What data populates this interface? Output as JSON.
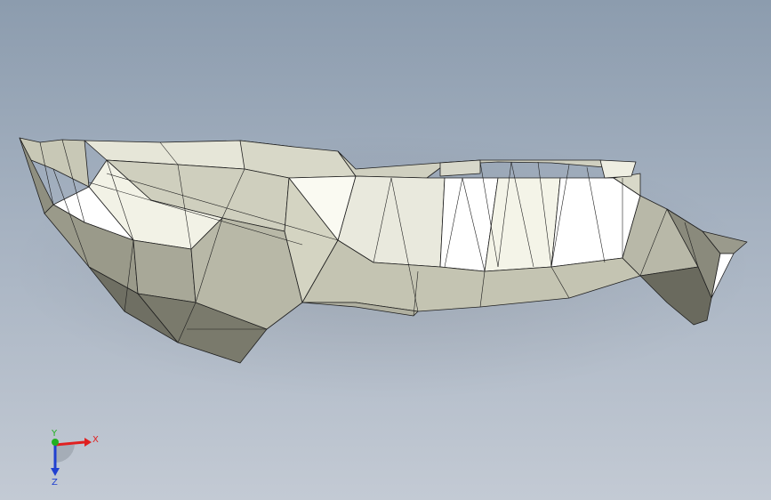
{
  "viewport": {
    "background_top": "#8c9cae",
    "background_bottom": "#c3cad4"
  },
  "model": {
    "icon": "mesh-part",
    "face_colors": {
      "highlight": "#ffffff",
      "light": "#e6e6d8",
      "mid": "#c8c8b6",
      "dark": "#8f8f80",
      "shadow": "#5f5f55"
    },
    "edge_color": "#1e1e1e"
  },
  "triad": {
    "x_label": "X",
    "y_label": "Y",
    "z_label": "Z",
    "x_color": "#e02020",
    "y_color": "#20b020",
    "z_color": "#2040d0"
  }
}
